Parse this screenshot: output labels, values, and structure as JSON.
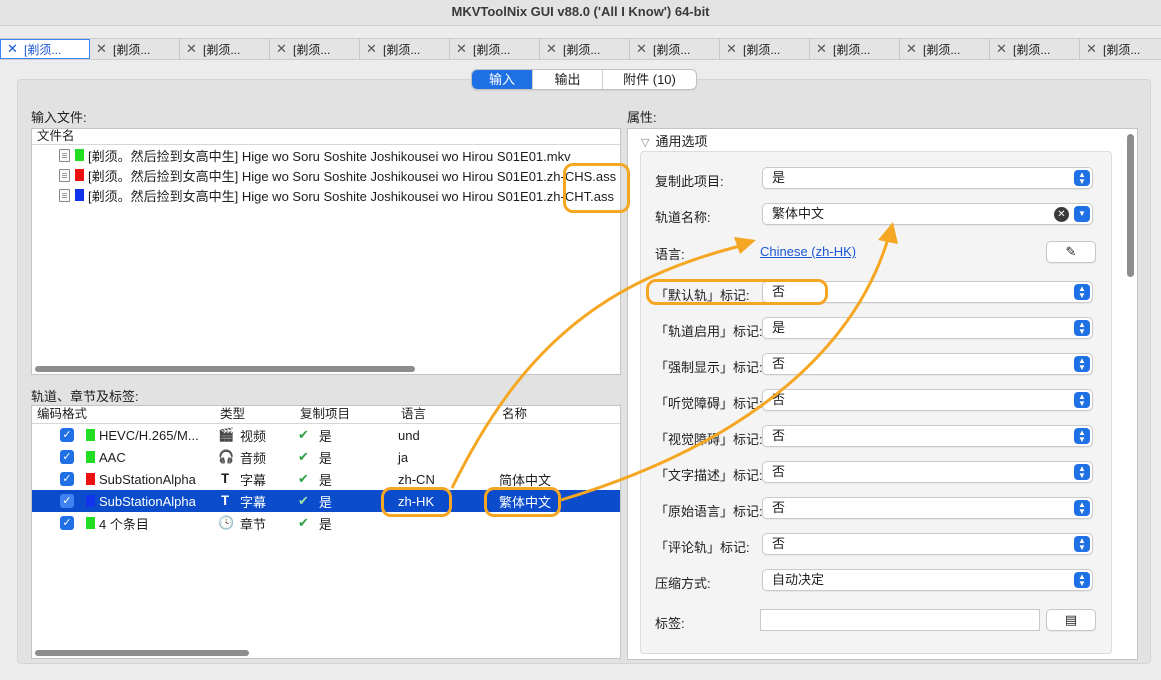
{
  "window": {
    "title": "MKVToolNix GUI v88.0 ('All I Know') 64-bit"
  },
  "tabs": [
    {
      "label": "[剃须..."
    },
    {
      "label": "[剃须..."
    },
    {
      "label": "[剃须..."
    },
    {
      "label": "[剃须..."
    },
    {
      "label": "[剃须..."
    },
    {
      "label": "[剃须..."
    },
    {
      "label": "[剃须..."
    },
    {
      "label": "[剃须..."
    },
    {
      "label": "[剃须..."
    },
    {
      "label": "[剃须..."
    },
    {
      "label": "[剃须..."
    },
    {
      "label": "[剃须..."
    },
    {
      "label": "[剃须..."
    }
  ],
  "segments": {
    "input": "输入",
    "output": "输出",
    "attachments": "附件 (10)"
  },
  "input_files": {
    "label": "输入文件:",
    "column": "文件名",
    "files": [
      {
        "color": "#22dd22",
        "name": "[剃须。然后捡到女高中生] Hige wo Soru Soshite Joshikousei wo Hirou S01E01.mkv"
      },
      {
        "color": "#ee1111",
        "name": "[剃须。然后捡到女高中生] Hige wo Soru Soshite Joshikousei wo Hirou S01E01.zh-CHS.ass"
      },
      {
        "color": "#1133ee",
        "name": "[剃须。然后捡到女高中生] Hige wo Soru Soshite Joshikousei wo Hirou S01E01.zh-CHT.ass"
      }
    ]
  },
  "tracks": {
    "label": "轨道、章节及标签:",
    "columns": [
      "编码格式",
      "类型",
      "复制项目",
      "语言",
      "名称"
    ],
    "rows": [
      {
        "color": "#22dd22",
        "codec": "HEVC/H.265/M...",
        "type_icon": "clapper-icon",
        "type_glyph": "🎬",
        "type": "视频",
        "copy": "是",
        "lang": "und",
        "name": ""
      },
      {
        "color": "#22dd22",
        "codec": "AAC",
        "type_icon": "headphones-icon",
        "type_glyph": "🎧",
        "type": "音频",
        "copy": "是",
        "lang": "ja",
        "name": ""
      },
      {
        "color": "#ee1111",
        "codec": "SubStationAlpha",
        "type_icon": "text-cursor-icon",
        "type_glyph": "𝐓",
        "type": "字幕",
        "copy": "是",
        "lang": "zh-CN",
        "name": "简体中文"
      },
      {
        "color": "#1133ee",
        "codec": "SubStationAlpha",
        "type_icon": "text-cursor-icon",
        "type_glyph": "𝐓",
        "type": "字幕",
        "copy": "是",
        "lang": "zh-HK",
        "name": "繁体中文"
      },
      {
        "color": "#22dd22",
        "codec": "4 个条目",
        "type_icon": "clock-icon",
        "type_glyph": "🕓",
        "type": "章节",
        "copy": "是",
        "lang": "",
        "name": ""
      }
    ]
  },
  "properties": {
    "label": "属性:",
    "section": "通用选项",
    "copy_item": {
      "label": "复制此项目:",
      "value": "是"
    },
    "track_name": {
      "label": "轨道名称:",
      "value": "繁体中文"
    },
    "language": {
      "label": "语言:",
      "value": "Chinese (zh-HK)"
    },
    "default_flag": {
      "label": "「默认轨」标记:",
      "value": "否"
    },
    "enabled_flag": {
      "label": "「轨道启用」标记:",
      "value": "是"
    },
    "forced_flag": {
      "label": "「强制显示」标记:",
      "value": "否"
    },
    "hearing_flag": {
      "label": "「听觉障碍」标记:",
      "value": "否"
    },
    "visual_flag": {
      "label": "「视觉障碍」标记:",
      "value": "否"
    },
    "text_desc_flag": {
      "label": "「文字描述」标记:",
      "value": "否"
    },
    "original_flag": {
      "label": "「原始语言」标记:",
      "value": "否"
    },
    "commentary_flag": {
      "label": "「评论轨」标记:",
      "value": "否"
    },
    "compression": {
      "label": "压缩方式:",
      "value": "自动决定"
    },
    "tags": {
      "label": "标签:",
      "value": ""
    }
  },
  "colors": {
    "accent": "#1f6fe5",
    "highlight": "#f5a623",
    "selection": "#0a4ccc"
  }
}
